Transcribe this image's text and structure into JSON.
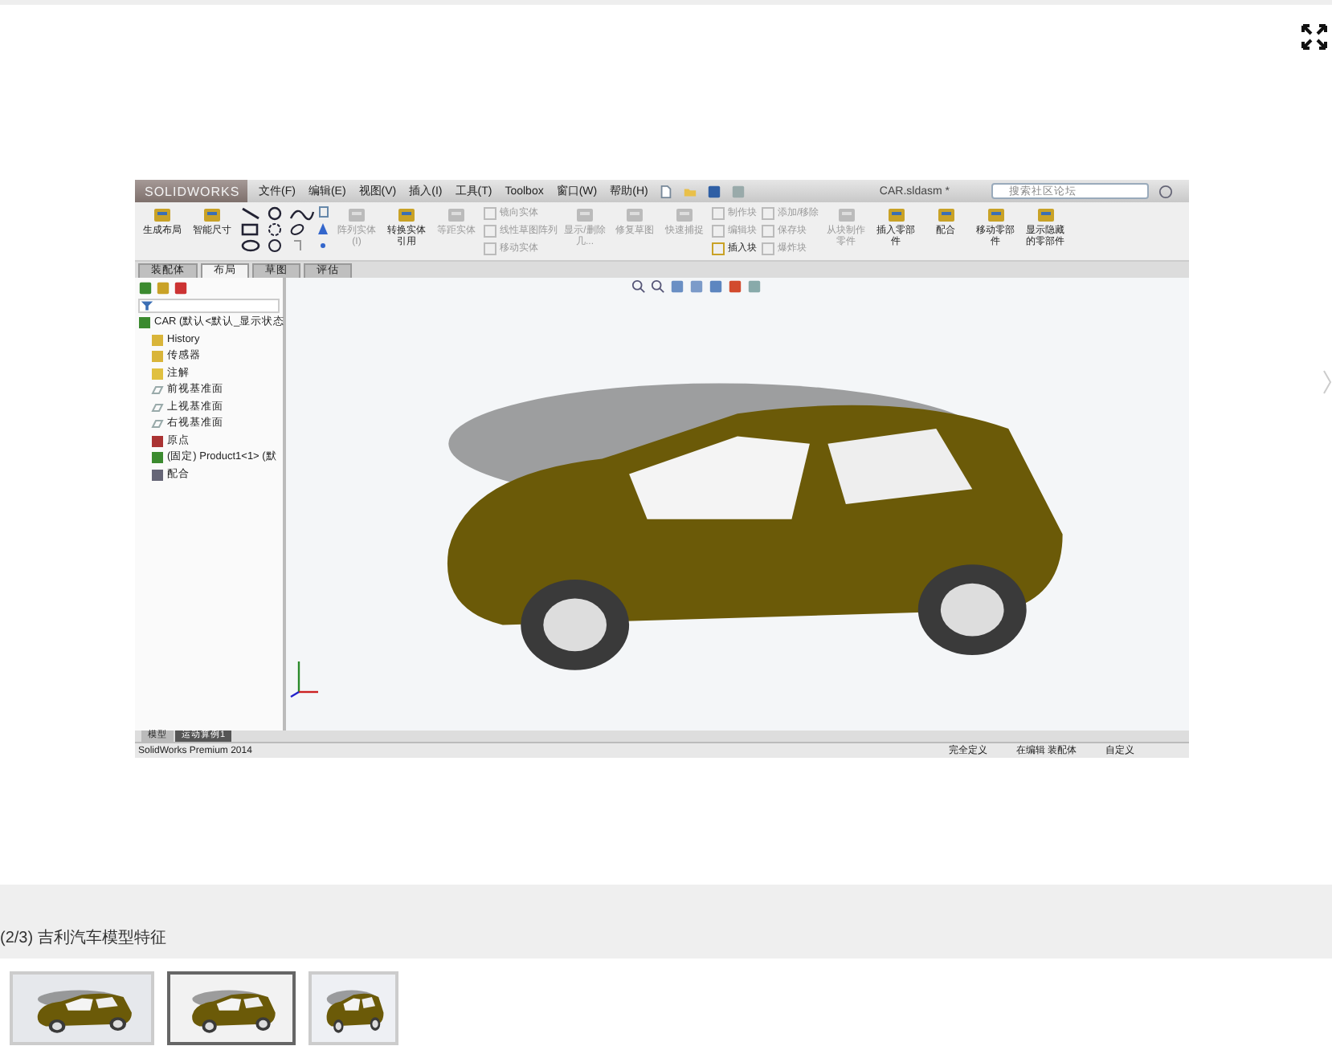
{
  "app": {
    "logo": "SOLIDWORKS",
    "menu": [
      "文件(F)",
      "编辑(E)",
      "视图(V)",
      "插入(I)",
      "工具(T)",
      "Toolbox",
      "窗口(W)",
      "帮助(H)"
    ],
    "document_title": "CAR.sldasm *",
    "search": {
      "placeholder": "搜索社区论坛"
    },
    "ribbon": [
      {
        "kind": "large",
        "label": "生成布局",
        "disabled": false
      },
      {
        "kind": "large",
        "label": "智能尺寸",
        "disabled": false
      },
      {
        "kind": "sketch"
      },
      {
        "kind": "large",
        "label": "阵列实体(I)",
        "disabled": true
      },
      {
        "kind": "large",
        "label": "转换实体引用",
        "disabled": false
      },
      {
        "kind": "large",
        "label": "等距实体",
        "disabled": true
      },
      {
        "kind": "stack",
        "items": [
          {
            "label": "镜向实体",
            "disabled": true
          },
          {
            "label": "线性草图阵列",
            "disabled": true
          },
          {
            "label": "移动实体",
            "disabled": true
          }
        ]
      },
      {
        "kind": "large",
        "label": "显示/删除几...",
        "disabled": true
      },
      {
        "kind": "large",
        "label": "修复草图",
        "disabled": true
      },
      {
        "kind": "large",
        "label": "快速捕捉",
        "disabled": true
      },
      {
        "kind": "stack",
        "items": [
          {
            "label": "制作块",
            "disabled": true
          },
          {
            "label": "编辑块",
            "disabled": true
          },
          {
            "label": "插入块",
            "disabled": false
          }
        ]
      },
      {
        "kind": "stack",
        "items": [
          {
            "label": "添加/移除",
            "disabled": true
          },
          {
            "label": "保存块",
            "disabled": true
          },
          {
            "label": "爆炸块",
            "disabled": true
          }
        ]
      },
      {
        "kind": "large",
        "label": "从块制作零件",
        "disabled": true
      },
      {
        "kind": "large",
        "label": "插入零部件",
        "disabled": false
      },
      {
        "kind": "large",
        "label": "配合",
        "disabled": false
      },
      {
        "kind": "large",
        "label": "移动零部件",
        "disabled": false
      },
      {
        "kind": "large",
        "label": "显示隐藏的零部件",
        "disabled": false
      }
    ],
    "tabs": [
      {
        "label": "装配体",
        "selected": false
      },
      {
        "label": "布局",
        "selected": true
      },
      {
        "label": "草图",
        "selected": false
      },
      {
        "label": "评估",
        "selected": false
      }
    ],
    "tree": [
      {
        "label": "CAR  (默认<默认_显示状态",
        "kind": "assembly",
        "children": [
          {
            "label": "History",
            "kind": "history"
          },
          {
            "label": "传感器",
            "kind": "sensor"
          },
          {
            "label": "注解",
            "kind": "annotation"
          },
          {
            "label": "前视基准面",
            "kind": "plane"
          },
          {
            "label": "上视基准面",
            "kind": "plane"
          },
          {
            "label": "右视基准面",
            "kind": "plane"
          },
          {
            "label": "原点",
            "kind": "origin"
          },
          {
            "label": "(固定) Product1<1> (默",
            "kind": "part"
          },
          {
            "label": "配合",
            "kind": "mates"
          }
        ]
      }
    ],
    "bottom_tabs": [
      {
        "label": "模型",
        "selected": false
      },
      {
        "label": "运动算例1",
        "selected": true
      }
    ],
    "status_bar": {
      "product": "SolidWorks Premium 2014",
      "items": [
        "完全定义",
        "在编辑 装配体",
        "自定义"
      ]
    }
  },
  "caption": "(2/3) 吉利汽车模型特征",
  "thumbnails": [
    {
      "selected": false
    },
    {
      "selected": true
    },
    {
      "selected": false
    }
  ]
}
